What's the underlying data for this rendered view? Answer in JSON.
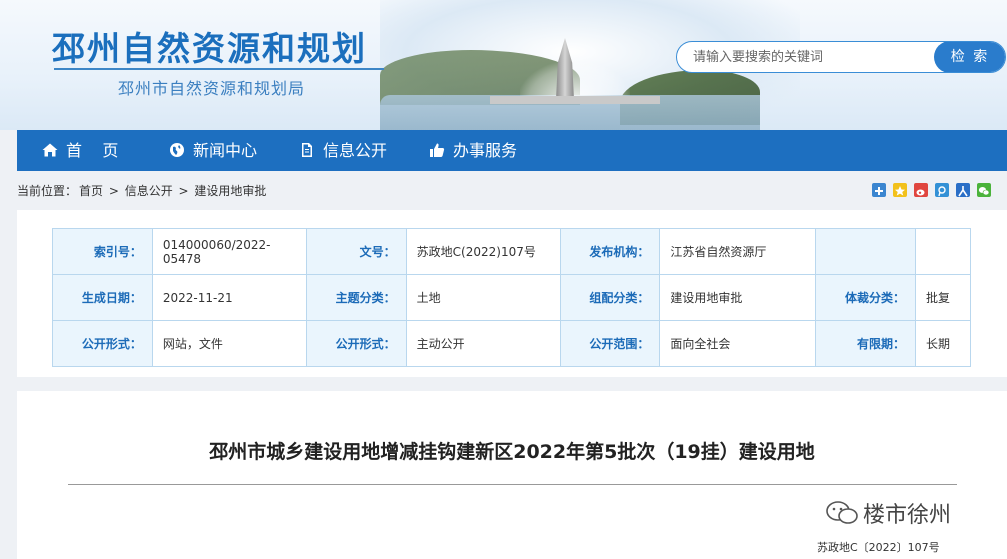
{
  "header": {
    "site_title": "邳州自然资源和规划",
    "site_subtitle": "邳州市自然资源和规划局",
    "search": {
      "placeholder": "请输入要搜索的关键词",
      "button_label": "检 索"
    }
  },
  "nav": {
    "items": [
      {
        "label": "首    页",
        "icon": "home-icon"
      },
      {
        "label": "新闻中心",
        "icon": "globe-icon"
      },
      {
        "label": "信息公开",
        "icon": "document-icon"
      },
      {
        "label": "办事服务",
        "icon": "thumbs-up-icon"
      }
    ]
  },
  "breadcrumb": {
    "prefix": "当前位置：",
    "items": [
      "首页",
      "信息公开",
      "建设用地审批"
    ],
    "separator": " > "
  },
  "share_icons": [
    "plus-share-icon",
    "qzone-icon",
    "weibo-icon",
    "tencent-weibo-icon",
    "renren-icon",
    "wechat-icon"
  ],
  "meta": {
    "rows": [
      [
        {
          "label": "索引号：",
          "value": "014000060/2022-05478"
        },
        {
          "label": "文号：",
          "value": "苏政地C(2022)107号"
        },
        {
          "label": "发布机构：",
          "value": "江苏省自然资源厅"
        },
        {
          "label": "",
          "value": ""
        }
      ],
      [
        {
          "label": "生成日期：",
          "value": "2022-11-21"
        },
        {
          "label": "主题分类：",
          "value": "土地"
        },
        {
          "label": "组配分类：",
          "value": "建设用地审批"
        },
        {
          "label": "体裁分类：",
          "value": "批复"
        }
      ],
      [
        {
          "label": "公开形式：",
          "value": "网站，文件"
        },
        {
          "label": "公开形式：",
          "value": "主动公开"
        },
        {
          "label": "公开范围：",
          "value": "面向全社会"
        },
        {
          "label": "有限期：",
          "value": "长期"
        }
      ]
    ]
  },
  "article": {
    "title": "邳州市城乡建设用地增减挂钩建新区2022年第5批次（19挂）建设用地",
    "watermark": "楼市徐州",
    "doc_number": "苏政地C〔2022〕107号"
  },
  "colors": {
    "primary": "#1d6fc0",
    "label_bg": "#eaf5fd",
    "border": "#b9d7ee"
  }
}
